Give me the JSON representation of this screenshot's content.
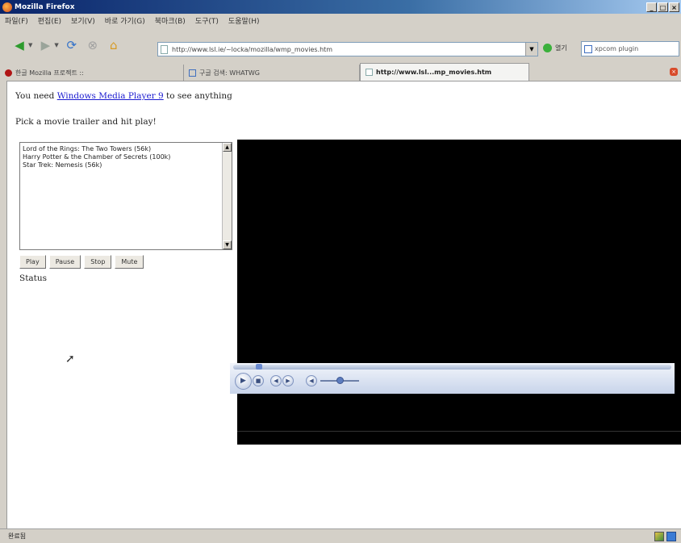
{
  "window": {
    "title": "Mozilla Firefox",
    "min": "_",
    "max": "□",
    "close": "×"
  },
  "menu": [
    "파일(F)",
    "편집(E)",
    "보기(V)",
    "바로 가기(G)",
    "북마크(B)",
    "도구(T)",
    "도움말(H)"
  ],
  "nav": {
    "back": "◀",
    "forward": "▶",
    "reload": "⟳",
    "stop": "⊗",
    "home": "⌂",
    "url": "http://www.lsl.ie/~locka/mozilla/wmp_movies.htm",
    "go_label": "열기",
    "search_placeholder": "xpcom plugin"
  },
  "tabs": [
    {
      "label": "한글 Mozilla 프로젝트 :: "
    },
    {
      "label": "구글 검색: WHATWG"
    },
    {
      "label": "http://www.lsl...mp_movies.htm"
    }
  ],
  "page": {
    "intro_before": "You need ",
    "intro_link": "Windows Media Player 9",
    "intro_after": " to see anything",
    "instruction": "Pick a movie trailer and hit play!",
    "movies": [
      "Lord of the Rings: The Two Towers (56k)",
      "Harry Potter & the Chamber of Secrets (100k)",
      "Star Trek: Nemesis (56k)"
    ],
    "buttons": {
      "play": "Play",
      "pause": "Pause",
      "stop": "Stop",
      "mute": "Mute"
    },
    "status_label": "Status"
  },
  "statusbar": {
    "text": "완료됨"
  },
  "icons": {
    "back": "back-arrow-icon",
    "forward": "forward-arrow-icon",
    "reload": "reload-icon",
    "stop": "stop-icon",
    "home": "home-icon",
    "cursor": "mouse-pointer-icon"
  }
}
